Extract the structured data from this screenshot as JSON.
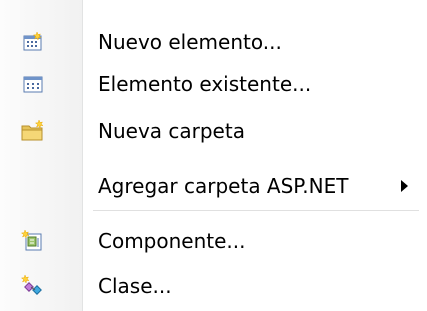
{
  "menu": {
    "items": [
      {
        "label": "Nuevo elemento...",
        "icon": "new-item-icon"
      },
      {
        "label": "Elemento existente...",
        "icon": "existing-item-icon"
      },
      {
        "label": "Nueva carpeta",
        "icon": "new-folder-icon"
      },
      {
        "label": "Agregar carpeta ASP.NET",
        "icon": "",
        "submenu": true
      },
      {
        "label": "Componente...",
        "icon": "component-icon"
      },
      {
        "label": "Clase...",
        "icon": "class-icon"
      }
    ]
  },
  "colors": {
    "gutter": "#f1f1f1",
    "separator": "#e0e0e0",
    "text": "#000000"
  }
}
